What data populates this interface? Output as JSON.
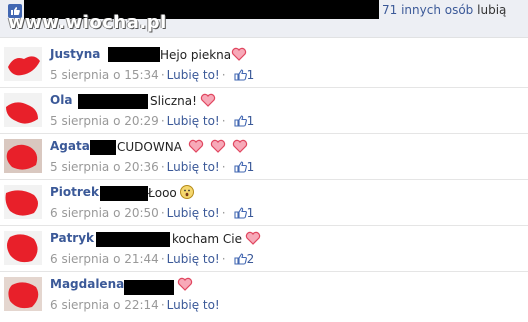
{
  "header": {
    "likes_link": "71 innych osób",
    "likes_suffix": "lubią",
    "watermark": "www.wiocha.pl"
  },
  "comments": [
    {
      "author": "Justyna",
      "text": "Hejo piekna",
      "date": "5 sierpnia o 15:34",
      "like_label": "Lubię to!",
      "likes": "1",
      "hearts": 1
    },
    {
      "author": "Ola",
      "text": "Sliczna!",
      "date": "5 sierpnia o 20:29",
      "like_label": "Lubię to!",
      "likes": "1",
      "hearts": 1
    },
    {
      "author": "Agata",
      "text": "CUDOWNA",
      "date": "5 sierpnia o 20:36",
      "like_label": "Lubię to!",
      "likes": "1",
      "hearts": 3
    },
    {
      "author": "Piotrek",
      "text": "Łooo",
      "date": "6 sierpnia o 20:50",
      "like_label": "Lubię to!",
      "likes": "1",
      "hearts": 0
    },
    {
      "author": "Patryk",
      "text": "kocham Cie",
      "date": "6 sierpnia o 21:44",
      "like_label": "Lubię to!",
      "likes": "2",
      "hearts": 1
    },
    {
      "author": "Magdalena",
      "text": "",
      "date": "6 sierpnia o 22:14",
      "like_label": "Lubię to!",
      "likes": "",
      "hearts": 1
    }
  ],
  "colors": {
    "link": "#3b5998",
    "meta": "#999999",
    "heart": "#e0465f",
    "redact": "#000000"
  }
}
